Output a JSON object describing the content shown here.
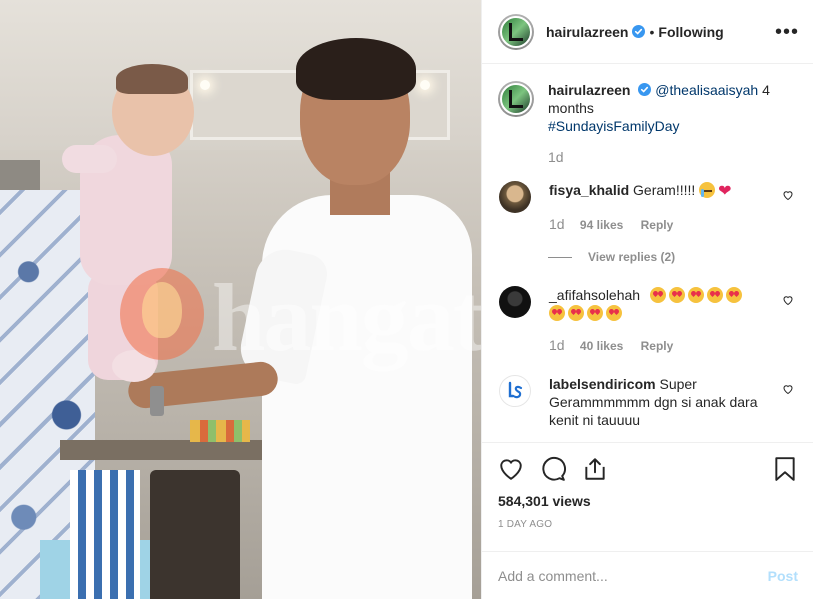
{
  "media": {
    "watermark": "hangat",
    "description_icon": "video-frame"
  },
  "header": {
    "username": "hairulazreen",
    "separator": "•",
    "follow_state": "Following",
    "more_icon": "ellipsis-icon"
  },
  "caption": {
    "username": "hairulazreen",
    "mention": "@thealisaaisyah",
    "text": "4 months",
    "hashtag": "#SundayisFamilyDay",
    "time": "1d"
  },
  "comments": [
    {
      "username": "fisya_khalid",
      "text": "Geram!!!!!",
      "time": "1d",
      "likes": "94 likes",
      "reply": "Reply",
      "view_replies": "View replies (2)"
    },
    {
      "username": "_afifahsolehah",
      "time": "1d",
      "likes": "40 likes",
      "reply": "Reply"
    },
    {
      "username": "labelsendiricom",
      "text": "Super Gerammmmmm dgn si anak dara kenit ni tauuuu"
    }
  ],
  "stats": {
    "views": "584,301 views",
    "ago": "1 DAY AGO"
  },
  "add_comment": {
    "placeholder": "Add a comment...",
    "post_label": "Post"
  },
  "colors": {
    "link": "#00376b",
    "muted": "#8e8e8e",
    "verified": "#3897f0",
    "post_disabled": "#b2dffc"
  }
}
